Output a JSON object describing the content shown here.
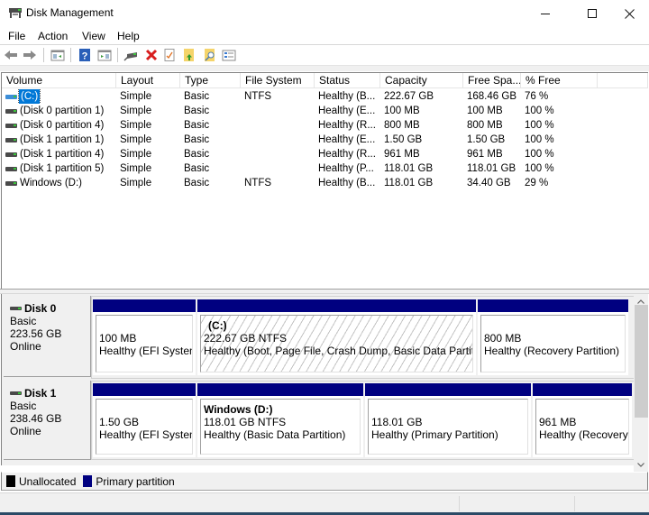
{
  "window": {
    "title": "Disk Management",
    "controls": {
      "minimize": "—",
      "maximize": "☐",
      "close": "✕"
    }
  },
  "menu": [
    "File",
    "Action",
    "View",
    "Help"
  ],
  "toolbar": {
    "buttons": [
      "back",
      "forward",
      "show-hide-console-tree",
      "help",
      "show-hide-action-pane",
      "connect-drive",
      "delete",
      "properties",
      "export-list",
      "open-folder",
      "volume-list"
    ]
  },
  "volume_list": {
    "columns": [
      "Volume",
      "Layout",
      "Type",
      "File System",
      "Status",
      "Capacity",
      "Free Spa...",
      "% Free"
    ],
    "rows": [
      {
        "volume": "(C:)",
        "layout": "Simple",
        "type": "Basic",
        "fs": "NTFS",
        "status": "Healthy (B...",
        "capacity": "222.67 GB",
        "free": "168.46 GB",
        "pct": "76 %",
        "selected": true
      },
      {
        "volume": "(Disk 0 partition 1)",
        "layout": "Simple",
        "type": "Basic",
        "fs": "",
        "status": "Healthy (E...",
        "capacity": "100 MB",
        "free": "100 MB",
        "pct": "100 %"
      },
      {
        "volume": "(Disk 0 partition 4)",
        "layout": "Simple",
        "type": "Basic",
        "fs": "",
        "status": "Healthy (R...",
        "capacity": "800 MB",
        "free": "800 MB",
        "pct": "100 %"
      },
      {
        "volume": "(Disk 1 partition 1)",
        "layout": "Simple",
        "type": "Basic",
        "fs": "",
        "status": "Healthy (E...",
        "capacity": "1.50 GB",
        "free": "1.50 GB",
        "pct": "100 %"
      },
      {
        "volume": "(Disk 1 partition 4)",
        "layout": "Simple",
        "type": "Basic",
        "fs": "",
        "status": "Healthy (R...",
        "capacity": "961 MB",
        "free": "961 MB",
        "pct": "100 %"
      },
      {
        "volume": "(Disk 1 partition 5)",
        "layout": "Simple",
        "type": "Basic",
        "fs": "",
        "status": "Healthy (P...",
        "capacity": "118.01 GB",
        "free": "118.01 GB",
        "pct": "100 %"
      },
      {
        "volume": "Windows (D:)",
        "layout": "Simple",
        "type": "Basic",
        "fs": "NTFS",
        "status": "Healthy (B...",
        "capacity": "118.01 GB",
        "free": "34.40 GB",
        "pct": "29 %"
      }
    ]
  },
  "disks": [
    {
      "name": "Disk 0",
      "type": "Basic",
      "size": "223.56 GB",
      "state": "Online",
      "partitions": [
        {
          "name": "",
          "size": "100 MB",
          "status": "Healthy (EFI System"
        },
        {
          "name": "(C:)",
          "size": "222.67 GB NTFS",
          "status": "Healthy (Boot, Page File, Crash Dump, Basic Data Partition)",
          "selected": true
        },
        {
          "name": "",
          "size": "800 MB",
          "status": "Healthy (Recovery Partition)"
        }
      ]
    },
    {
      "name": "Disk 1",
      "type": "Basic",
      "size": "238.46 GB",
      "state": "Online",
      "partitions": [
        {
          "name": "",
          "size": "1.50 GB",
          "status": "Healthy (EFI System"
        },
        {
          "name": "Windows  (D:)",
          "size": "118.01 GB NTFS",
          "status": "Healthy (Basic Data Partition)"
        },
        {
          "name": "",
          "size": "118.01 GB",
          "status": "Healthy (Primary Partition)"
        },
        {
          "name": "",
          "size": "961 MB",
          "status": "Healthy (Recovery"
        }
      ]
    }
  ],
  "legend": [
    {
      "label": "Unallocated",
      "color": "#000000"
    },
    {
      "label": "Primary partition",
      "color": "#000080"
    }
  ],
  "colors": {
    "primary_partition": "#000080",
    "selection": "#0078d7"
  }
}
